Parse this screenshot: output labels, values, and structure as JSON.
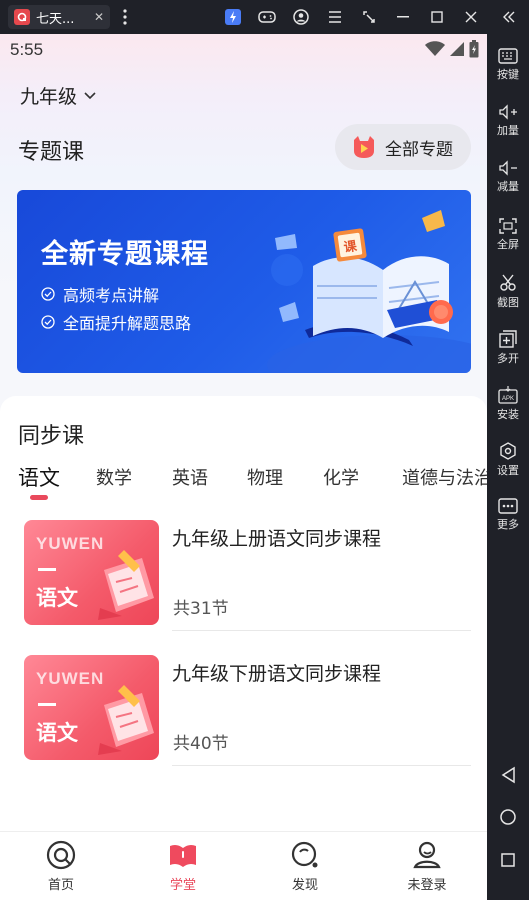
{
  "window": {
    "tab_title": "七天...",
    "tab_close": "✕"
  },
  "sidebar": {
    "items": [
      {
        "label": "按键",
        "icon": "keyboard-icon"
      },
      {
        "label": "加量",
        "icon": "volume-up-icon"
      },
      {
        "label": "减量",
        "icon": "volume-down-icon"
      },
      {
        "label": "全屏",
        "icon": "fullscreen-icon"
      },
      {
        "label": "截图",
        "icon": "scissors-icon"
      },
      {
        "label": "多开",
        "icon": "multi-instance-icon"
      },
      {
        "label": "安装",
        "icon": "apk-install-icon"
      },
      {
        "label": "设置",
        "icon": "settings-icon"
      },
      {
        "label": "更多",
        "icon": "more-icon"
      }
    ]
  },
  "status_bar": {
    "time": "5:55"
  },
  "grade_selector": {
    "label": "九年级"
  },
  "topics": {
    "title": "专题课",
    "all_button": "全部专题",
    "banner": {
      "title": "全新专题课程",
      "items": [
        "高频考点讲解",
        "全面提升解题思路"
      ],
      "badge": "课"
    }
  },
  "sync": {
    "title": "同步课",
    "subjects": [
      "语文",
      "数学",
      "英语",
      "物理",
      "化学",
      "道德与法治"
    ],
    "active_subject": "语文",
    "courses": [
      {
        "title": "九年级上册语文同步课程",
        "count": "共31节",
        "thumb_en": "YUWEN",
        "thumb_cn": "语文"
      },
      {
        "title": "九年级下册语文同步课程",
        "count": "共40节",
        "thumb_en": "YUWEN",
        "thumb_cn": "语文"
      }
    ]
  },
  "bottom_nav": [
    {
      "label": "首页",
      "icon": "home-icon",
      "active": false
    },
    {
      "label": "学堂",
      "icon": "book-icon",
      "active": true
    },
    {
      "label": "发现",
      "icon": "discover-icon",
      "active": false
    },
    {
      "label": "未登录",
      "icon": "user-icon",
      "active": false
    }
  ],
  "colors": {
    "accent": "#e9495c",
    "banner_blue": "#1f5ce8",
    "emulator_bg": "#1f2128"
  }
}
